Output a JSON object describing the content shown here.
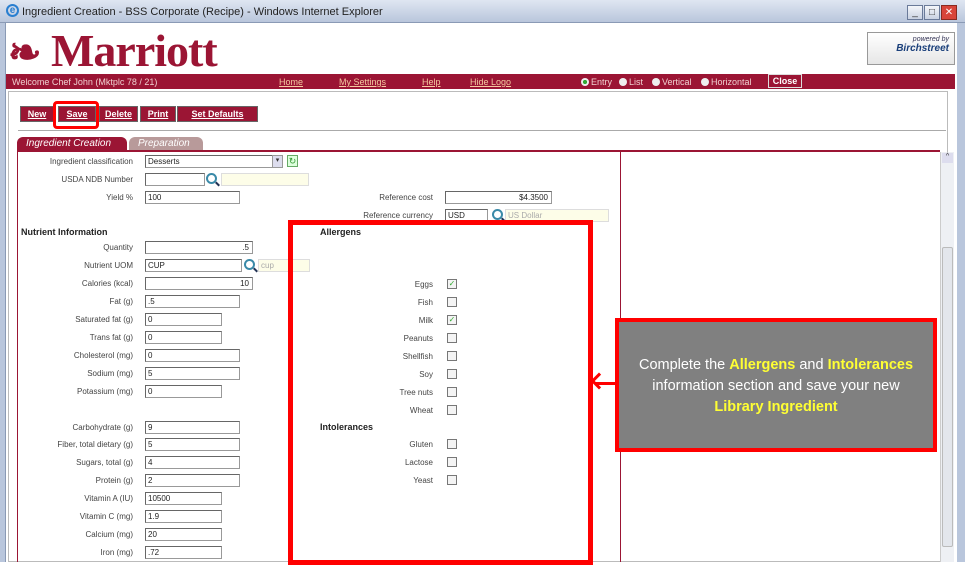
{
  "window": {
    "title": "Ingredient Creation - BSS Corporate (Recipe) - Windows Internet Explorer",
    "minimize": "_",
    "maximize": "□",
    "close": "✕"
  },
  "logo": {
    "text": "Marriott"
  },
  "powered": {
    "line1": "powered by",
    "line2": "Birchstreet"
  },
  "nav": {
    "welcome": "Welcome Chef John (Mktplc 78 / 21)",
    "links": [
      "Home",
      "My Settings",
      "Help",
      "Hide Logo"
    ],
    "views": [
      {
        "label": "Entry",
        "selected": true
      },
      {
        "label": "List",
        "selected": false
      },
      {
        "label": "Vertical",
        "selected": false
      },
      {
        "label": "Horizontal",
        "selected": false
      }
    ],
    "close": "Close"
  },
  "toolbar": [
    "New",
    "Save",
    "Delete",
    "Print",
    "Set Defaults"
  ],
  "tabs": [
    "Ingredient Creation",
    "Preparation"
  ],
  "form": {
    "top": [
      {
        "label": "Ingredient classification",
        "value": "Desserts"
      },
      {
        "label": "USDA NDB Number",
        "value": ""
      },
      {
        "label": "Yield %",
        "value": "100"
      }
    ],
    "nutrient_heading": "Nutrient Information",
    "nutrients": [
      {
        "label": "Quantity",
        "value": ".5"
      },
      {
        "label": "Nutrient UOM",
        "value": "CUP",
        "desc": "cup"
      },
      {
        "label": "Calories (kcal)",
        "value": "10"
      },
      {
        "label": "Fat (g)",
        "value": ".5"
      },
      {
        "label": "Saturated fat (g)",
        "value": "0"
      },
      {
        "label": "Trans fat (g)",
        "value": "0"
      },
      {
        "label": "Cholesterol (mg)",
        "value": "0"
      },
      {
        "label": "Sodium (mg)",
        "value": "5"
      },
      {
        "label": "Potassium (mg)",
        "value": "0"
      }
    ],
    "nutrients2": [
      {
        "label": "Carbohydrate (g)",
        "value": "9"
      },
      {
        "label": "Fiber, total dietary (g)",
        "value": "5"
      },
      {
        "label": "Sugars, total (g)",
        "value": "4"
      },
      {
        "label": "Protein (g)",
        "value": "2"
      },
      {
        "label": "Vitamin A (IU)",
        "value": "10500"
      },
      {
        "label": "Vitamin C (mg)",
        "value": "1.9"
      },
      {
        "label": "Calcium (mg)",
        "value": "20"
      },
      {
        "label": "Iron (mg)",
        "value": ".72"
      }
    ],
    "reference_cost": {
      "label": "Reference cost",
      "value": "$4.3500"
    },
    "reference_currency": {
      "label": "Reference currency",
      "value": "USD",
      "desc": "US Dollar"
    },
    "allergens_heading": "Allergens",
    "allergens": [
      {
        "label": "Eggs",
        "checked": true
      },
      {
        "label": "Fish",
        "checked": false
      },
      {
        "label": "Milk",
        "checked": true
      },
      {
        "label": "Peanuts",
        "checked": false
      },
      {
        "label": "Shellfish",
        "checked": false
      },
      {
        "label": "Soy",
        "checked": false
      },
      {
        "label": "Tree nuts",
        "checked": false
      },
      {
        "label": "Wheat",
        "checked": false
      }
    ],
    "intolerances_heading": "Intolerances",
    "intolerances": [
      {
        "label": "Gluten",
        "checked": false
      },
      {
        "label": "Lactose",
        "checked": false
      },
      {
        "label": "Yeast",
        "checked": false
      }
    ]
  },
  "callout": {
    "p1": "Complete the ",
    "h1": "Allergens",
    "p2": " and ",
    "h2": "Intolerances",
    "p3": " information section and save your new ",
    "h3": "Library Ingredient"
  },
  "colors": {
    "brand": "#9b1534",
    "highlight": "#ff0000",
    "callout_bg": "#808080",
    "callout_accent": "#ffff33"
  }
}
